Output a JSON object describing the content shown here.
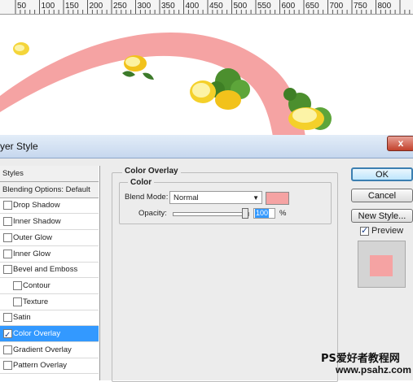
{
  "ruler": {
    "ticks": [
      "50",
      "100",
      "150",
      "200",
      "250",
      "300",
      "350",
      "400",
      "450",
      "500",
      "550",
      "600",
      "650",
      "700",
      "750",
      "800"
    ]
  },
  "canvas": {
    "arc_color": "#f5a3a3"
  },
  "dialog": {
    "title": "yer Style",
    "close_label": "x",
    "styles_list": [
      {
        "label": "Styles",
        "kind": "header"
      },
      {
        "label": "Blending Options: Default",
        "kind": "header"
      },
      {
        "label": "Drop Shadow",
        "kind": "checkbox",
        "checked": false
      },
      {
        "label": "Inner Shadow",
        "kind": "checkbox",
        "checked": false
      },
      {
        "label": "Outer Glow",
        "kind": "checkbox",
        "checked": false
      },
      {
        "label": "Inner Glow",
        "kind": "checkbox",
        "checked": false
      },
      {
        "label": "Bevel and Emboss",
        "kind": "checkbox",
        "checked": false
      },
      {
        "label": "Contour",
        "kind": "sub",
        "checked": false
      },
      {
        "label": "Texture",
        "kind": "sub",
        "checked": false
      },
      {
        "label": "Satin",
        "kind": "checkbox",
        "checked": false
      },
      {
        "label": "Color Overlay",
        "kind": "checkbox",
        "checked": true,
        "selected": true
      },
      {
        "label": "Gradient Overlay",
        "kind": "checkbox",
        "checked": false
      },
      {
        "label": "Pattern Overlay",
        "kind": "checkbox",
        "checked": false
      }
    ],
    "panel": {
      "group_title": "Color Overlay",
      "inner_title": "Color",
      "blend_mode_label": "Blend Mode:",
      "blend_mode_value": "Normal",
      "overlay_color": "#f5a3a3",
      "opacity_label": "Opacity:",
      "opacity_value": "100",
      "opacity_unit": "%"
    },
    "buttons": {
      "ok": "OK",
      "cancel": "Cancel",
      "new_style": "New Style..."
    },
    "preview_label": "Preview",
    "preview_checked": true
  },
  "watermark": {
    "line1": "PS爱好者教程网",
    "line2": "www.psahz.com"
  }
}
